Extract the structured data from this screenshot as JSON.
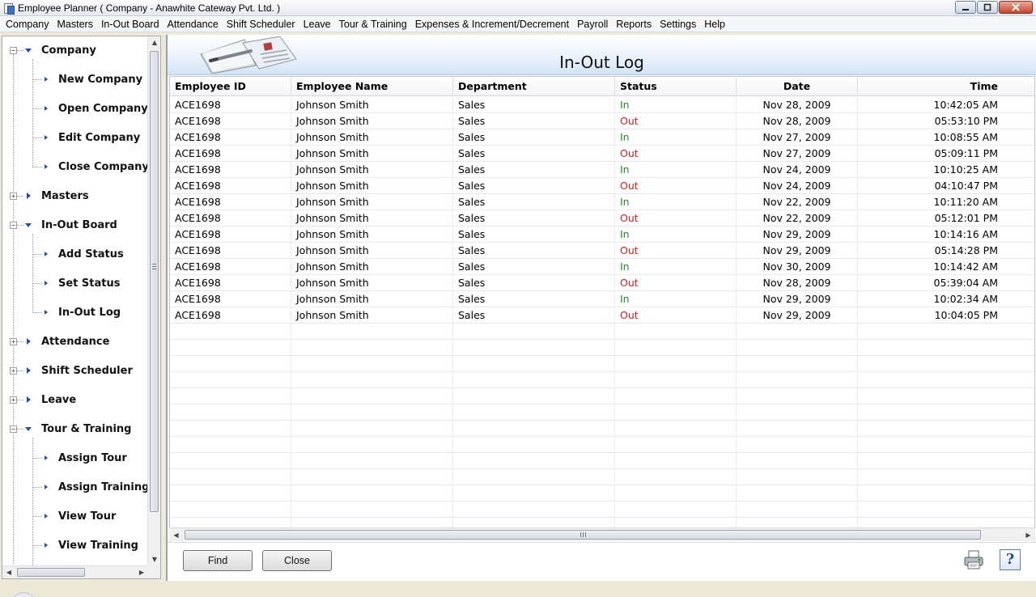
{
  "window": {
    "title": "Employee Planner ( Company - Anawhite Cateway Pvt. Ltd. )"
  },
  "menu": [
    "Company",
    "Masters",
    "In-Out Board",
    "Attendance",
    "Shift Scheduler",
    "Leave",
    "Tour & Training",
    "Expenses & Increment/Decrement",
    "Payroll",
    "Reports",
    "Settings",
    "Help"
  ],
  "tree": {
    "company": "Company",
    "new_company": "New Company",
    "open_company": "Open Company",
    "edit_company": "Edit Company",
    "close_company": "Close Company",
    "masters": "Masters",
    "in_out_board": "In-Out Board",
    "add_status": "Add Status",
    "set_status": "Set Status",
    "in_out_log": "In-Out Log",
    "attendance": "Attendance",
    "shift_scheduler": "Shift Scheduler",
    "leave": "Leave",
    "tour_training": "Tour & Training",
    "assign_tour": "Assign Tour",
    "assign_training": "Assign Training",
    "view_tour": "View Tour",
    "view_training": "View Training"
  },
  "page": {
    "title": "In-Out Log"
  },
  "table": {
    "columns": [
      "Employee ID",
      "Employee Name",
      "Department",
      "Status",
      "Date",
      "Time"
    ],
    "rows": [
      [
        "ACE1698",
        "Johnson Smith",
        "Sales",
        "In",
        "Nov 28, 2009",
        "10:42:05 AM"
      ],
      [
        "ACE1698",
        "Johnson Smith",
        "Sales",
        "Out",
        "Nov 28, 2009",
        "05:53:10 PM"
      ],
      [
        "ACE1698",
        "Johnson Smith",
        "Sales",
        "In",
        "Nov 27, 2009",
        "10:08:55 AM"
      ],
      [
        "ACE1698",
        "Johnson Smith",
        "Sales",
        "Out",
        "Nov 27, 2009",
        "05:09:11 PM"
      ],
      [
        "ACE1698",
        "Johnson Smith",
        "Sales",
        "In",
        "Nov 24, 2009",
        "10:10:25 AM"
      ],
      [
        "ACE1698",
        "Johnson Smith",
        "Sales",
        "Out",
        "Nov 24, 2009",
        "04:10:47 PM"
      ],
      [
        "ACE1698",
        "Johnson Smith",
        "Sales",
        "In",
        "Nov 22, 2009",
        "10:11:20 AM"
      ],
      [
        "ACE1698",
        "Johnson Smith",
        "Sales",
        "Out",
        "Nov 22, 2009",
        "05:12:01 PM"
      ],
      [
        "ACE1698",
        "Johnson Smith",
        "Sales",
        "In",
        "Nov 29, 2009",
        "10:14:16 AM"
      ],
      [
        "ACE1698",
        "Johnson Smith",
        "Sales",
        "Out",
        "Nov 29, 2009",
        "05:14:28 PM"
      ],
      [
        "ACE1698",
        "Johnson Smith",
        "Sales",
        "In",
        "Nov 30, 2009",
        "10:14:42 AM"
      ],
      [
        "ACE1698",
        "Johnson Smith",
        "Sales",
        "Out",
        "Nov 28, 2009",
        "05:39:04 AM"
      ],
      [
        "ACE1698",
        "Johnson Smith",
        "Sales",
        "In",
        "Nov 29, 2009",
        "10:02:34 AM"
      ],
      [
        "ACE1698",
        "Johnson Smith",
        "Sales",
        "Out",
        "Nov 29, 2009",
        "10:04:05 PM"
      ]
    ]
  },
  "buttons": {
    "find": "Find",
    "close": "Close"
  },
  "colors": {
    "in": "#1d8a1d",
    "out": "#d21e1e",
    "tree_arrow": "#1f4fa8",
    "header_band": "#d2e3f6"
  },
  "icons": {
    "print": "printer-icon",
    "help": "help-icon"
  },
  "help_glyph": "?"
}
